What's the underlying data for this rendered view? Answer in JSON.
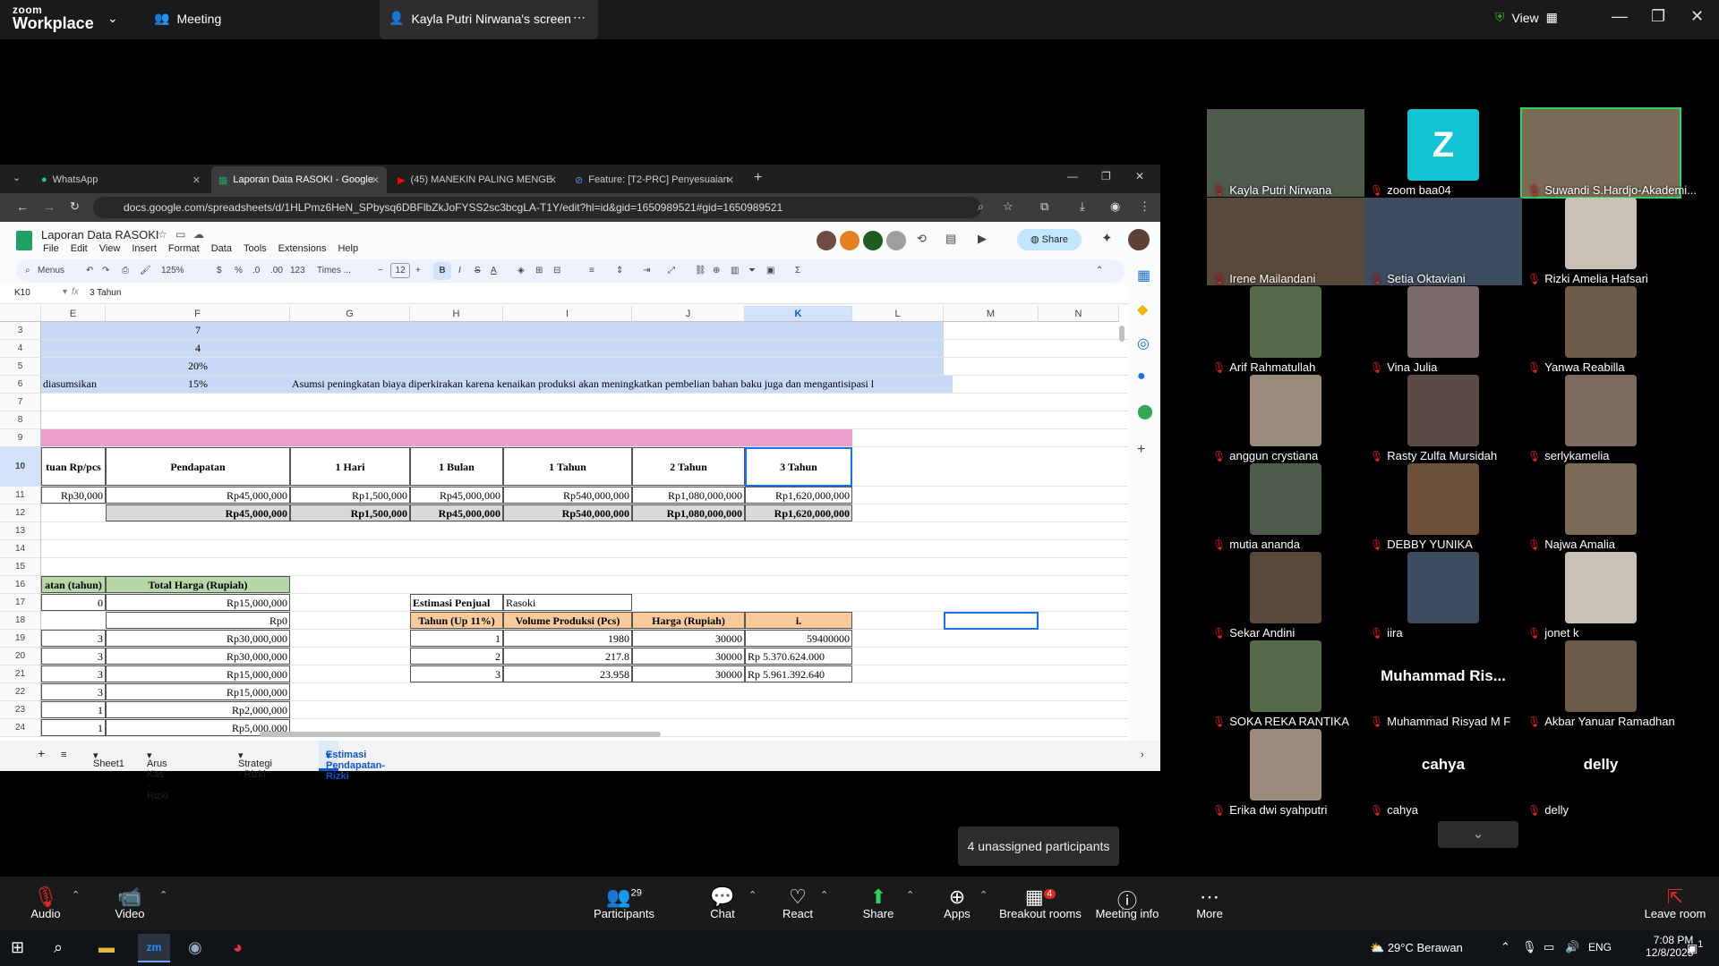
{
  "zoom": {
    "logo_line1": "zoom",
    "logo_line2": "Workplace",
    "meeting_label": "Meeting",
    "share_label": "Kayla Putri Nirwana's screen",
    "view_label": "View"
  },
  "browser": {
    "tabs": [
      {
        "label": "WhatsApp"
      },
      {
        "label": "Laporan Data RASOKI - Google"
      },
      {
        "label": "(45) MANEKIN PALING MENGE"
      },
      {
        "label": "Feature: [T2-PRC] Penyesuaian"
      }
    ],
    "url": "docs.google.com/spreadsheets/d/1HLPmz6HeN_SPbysq6DBFlbZkJoFYSS2sc3bcgLA-T1Y/edit?hl=id&gid=1650989521#gid=1650989521"
  },
  "sheet": {
    "title": "Laporan Data RASOKI",
    "menus": [
      "File",
      "Edit",
      "View",
      "Insert",
      "Format",
      "Data",
      "Tools",
      "Extensions",
      "Help"
    ],
    "toolbar": {
      "menus": "Menus",
      "zoom": "125%",
      "currency": "$",
      "percent": "%",
      "dec_less": ".0",
      "dec_more": ".00",
      "num_fmt": "123",
      "font": "Times ...",
      "font_size": "12",
      "bold": "B",
      "italic": "I",
      "strike": "S"
    },
    "share_label": "Share",
    "cell_ref": "K10",
    "formula": "3 Tahun",
    "columns": [
      "E",
      "F",
      "G",
      "H",
      "I",
      "J",
      "K",
      "L",
      "M",
      "N"
    ],
    "rows": [
      "3",
      "4",
      "5",
      "6",
      "7",
      "8",
      "9",
      "10",
      "11",
      "12",
      "13",
      "14",
      "15",
      "16",
      "17",
      "18",
      "19",
      "20",
      "21",
      "22",
      "23",
      "24"
    ],
    "cells": {
      "f3": "7",
      "f4": "4",
      "f5": "20%",
      "e6": "diasumsikan",
      "f6": "15%",
      "g6": "Asumsi peningkatan biaya diperkirakan karena kenaikan produksi akan meningkatkan pembelian bahan baku juga dan mengantisipasi l",
      "e10": "tuan Rp/pcs",
      "f10": "Pendapatan",
      "g10": "1 Hari",
      "h10": "1 Bulan",
      "i10": "1 Tahun",
      "j10": "2 Tahun",
      "k10": "3 Tahun",
      "e11": "Rp30,000",
      "f11": "Rp45,000,000",
      "g11": "Rp1,500,000",
      "h11": "Rp45,000,000",
      "i11": "Rp540,000,000",
      "j11": "Rp1,080,000,000",
      "k11": "Rp1,620,000,000",
      "f12": "Rp45,000,000",
      "g12": "Rp1,500,000",
      "h12": "Rp45,000,000",
      "i12": "Rp540,000,000",
      "j12": "Rp1,080,000,000",
      "k12": "Rp1,620,000,000",
      "e16": "atan (tahun)",
      "f16": "Total Harga (Rupiah)",
      "e17": "0",
      "f17": "Rp15,000,000",
      "h17": "Estimasi Penjual",
      "i17": "Rasoki",
      "f18": "Rp0",
      "h18": "Tahun (Up 11%)",
      "i18": "Volume Produksi (Pcs)",
      "j18": "Harga (Rupiah)",
      "k18": "i.",
      "e19": "3",
      "f19": "Rp30,000,000",
      "h19": "1",
      "i19": "1980",
      "j19": "30000",
      "k19": "59400000",
      "e20": "3",
      "f20": "Rp30,000,000",
      "h20": "2",
      "i20": "217.8",
      "j20": "30000",
      "k20": "Rp 5.370.624.000",
      "e21": "3",
      "f21": "Rp15,000,000",
      "h21": "3",
      "i21": "23.958",
      "j21": "30000",
      "k21": "Rp 5.961.392.640",
      "e22": "3",
      "f22": "Rp15,000,000",
      "e23": "1",
      "f23": "Rp2,000,000",
      "e24": "1",
      "f24": "Rp5,000,000"
    },
    "sheet_tabs": [
      "Sheet1",
      "Arus Kas - Rizki",
      "Strategi - Rizki",
      "Estimasi Pendapatan-Rizki"
    ]
  },
  "participants": [
    {
      "name": "Kayla Putri Nirwana",
      "video": true
    },
    {
      "name": "zoom baa04",
      "initial": "Z"
    },
    {
      "name": "Suwandi S.Hardjo-Akademi...",
      "video": true
    },
    {
      "name": "Irene Mailandani",
      "video": true
    },
    {
      "name": "Setia Oktaviani",
      "video": true
    },
    {
      "name": "Rizki Amelia Hafsari",
      "video": true
    },
    {
      "name": "Arif Rahmatullah",
      "video": true
    },
    {
      "name": "Vina Julia",
      "video": true
    },
    {
      "name": "Yanwa Reabilla",
      "video": true
    },
    {
      "name": "anggun crystiana",
      "video": true
    },
    {
      "name": "Rasty Zulfa Mursidah",
      "video": true
    },
    {
      "name": "serlykamelia",
      "video": true
    },
    {
      "name": "mutia ananda",
      "video": true
    },
    {
      "name": "DEBBY YUNIKA",
      "video": true
    },
    {
      "name": "Najwa Amalia",
      "video": true
    },
    {
      "name": "Sekar Andini",
      "video": true
    },
    {
      "name": "iira",
      "video": true
    },
    {
      "name": "jonet k",
      "video": true
    },
    {
      "name": "SOKA REKA RANTIKA",
      "video": true
    },
    {
      "name": "Muhammad Risyad M F",
      "big": "Muhammad Ris..."
    },
    {
      "name": "Akbar Yanuar Ramadhan",
      "video": true
    },
    {
      "name": "Erika dwi syahputri",
      "video": true
    },
    {
      "name": "cahya",
      "big": "cahya"
    },
    {
      "name": "delly",
      "big": "delly"
    }
  ],
  "unassigned": "4 unassigned participants",
  "controls": {
    "audio": "Audio",
    "video": "Video",
    "participants": "Participants",
    "participants_count": "29",
    "chat": "Chat",
    "react": "React",
    "share": "Share",
    "apps": "Apps",
    "breakout": "Breakout rooms",
    "breakout_badge": "4",
    "info": "Meeting info",
    "more": "More",
    "leave": "Leave room"
  },
  "taskbar": {
    "weather": "29°C Berawan",
    "lang": "ENG",
    "time": "7:08 PM",
    "date": "12/8/2025",
    "notif": "1"
  }
}
